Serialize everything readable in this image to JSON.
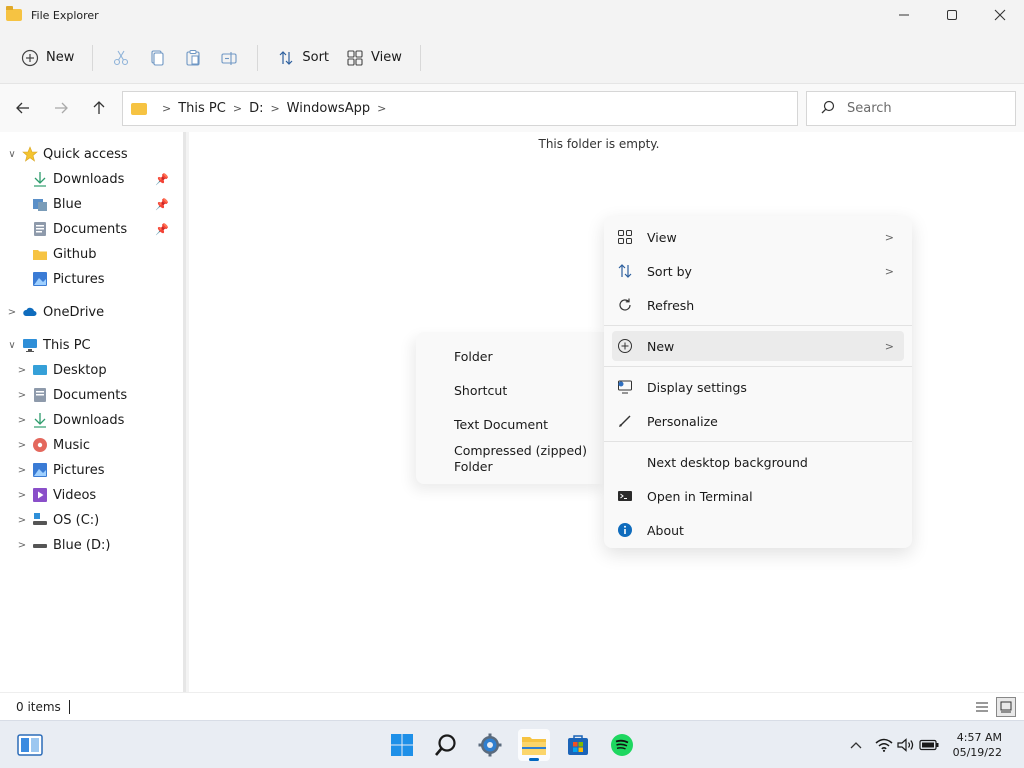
{
  "window": {
    "title": "File Explorer"
  },
  "toolbar": {
    "new_label": "New",
    "sort_label": "Sort",
    "view_label": "View"
  },
  "address": {
    "crumbs": [
      "This PC",
      "D:",
      "WindowsApp"
    ]
  },
  "search": {
    "placeholder": "Search"
  },
  "sidebar": {
    "quick_access": "Quick access",
    "quick_items": [
      "Downloads",
      "Blue",
      "Documents",
      "Github",
      "Pictures"
    ],
    "onedrive": "OneDrive",
    "this_pc": "This PC",
    "pc_items": [
      "Desktop",
      "Documents",
      "Downloads",
      "Music",
      "Pictures",
      "Videos",
      "OS (C:)",
      "Blue (D:)"
    ]
  },
  "content": {
    "empty_message": "This folder is empty."
  },
  "status": {
    "items": "0 items"
  },
  "context_menu": {
    "items": [
      "View",
      "Sort by",
      "Refresh",
      "New",
      "Display settings",
      "Personalize",
      "Next desktop background",
      "Open in Terminal",
      "About"
    ]
  },
  "new_submenu": {
    "items": [
      "Folder",
      "Shortcut",
      "Text Document",
      "Compressed (zipped) Folder"
    ]
  },
  "clock": {
    "time": "4:57 AM",
    "date": "05/19/22"
  },
  "colors": {
    "accent": "#0067c0",
    "folder": "#f6c342"
  }
}
